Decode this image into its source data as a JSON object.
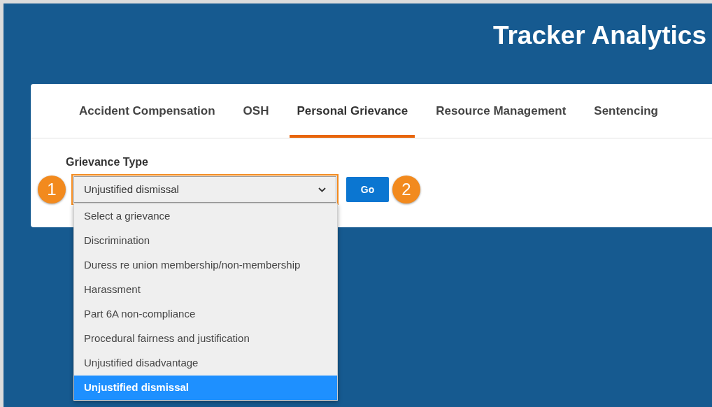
{
  "header": {
    "title": "Tracker Analytics"
  },
  "tabs": [
    {
      "label": "Accident Compensation",
      "selected": false
    },
    {
      "label": "OSH",
      "selected": false
    },
    {
      "label": "Personal Grievance",
      "selected": true
    },
    {
      "label": "Resource Management",
      "selected": false
    },
    {
      "label": "Sentencing",
      "selected": false
    }
  ],
  "filter": {
    "label": "Grievance Type",
    "value": "Unjustified dismissal",
    "highlighted": true,
    "expanded": true,
    "select_callout": "1",
    "go_button": "Go",
    "button_callout": "2",
    "options": [
      {
        "label": "Select a grievance",
        "selected": false
      },
      {
        "label": "Discrimination",
        "selected": false
      },
      {
        "label": "Duress re union membership/non-membership",
        "selected": false
      },
      {
        "label": "Harassment",
        "selected": false
      },
      {
        "label": "Part 6A non-compliance",
        "selected": false
      },
      {
        "label": "Procedural fairness and justification",
        "selected": false
      },
      {
        "label": "Unjustified disadvantage",
        "selected": false
      },
      {
        "label": "Unjustified dismissal",
        "selected": true
      }
    ]
  }
}
